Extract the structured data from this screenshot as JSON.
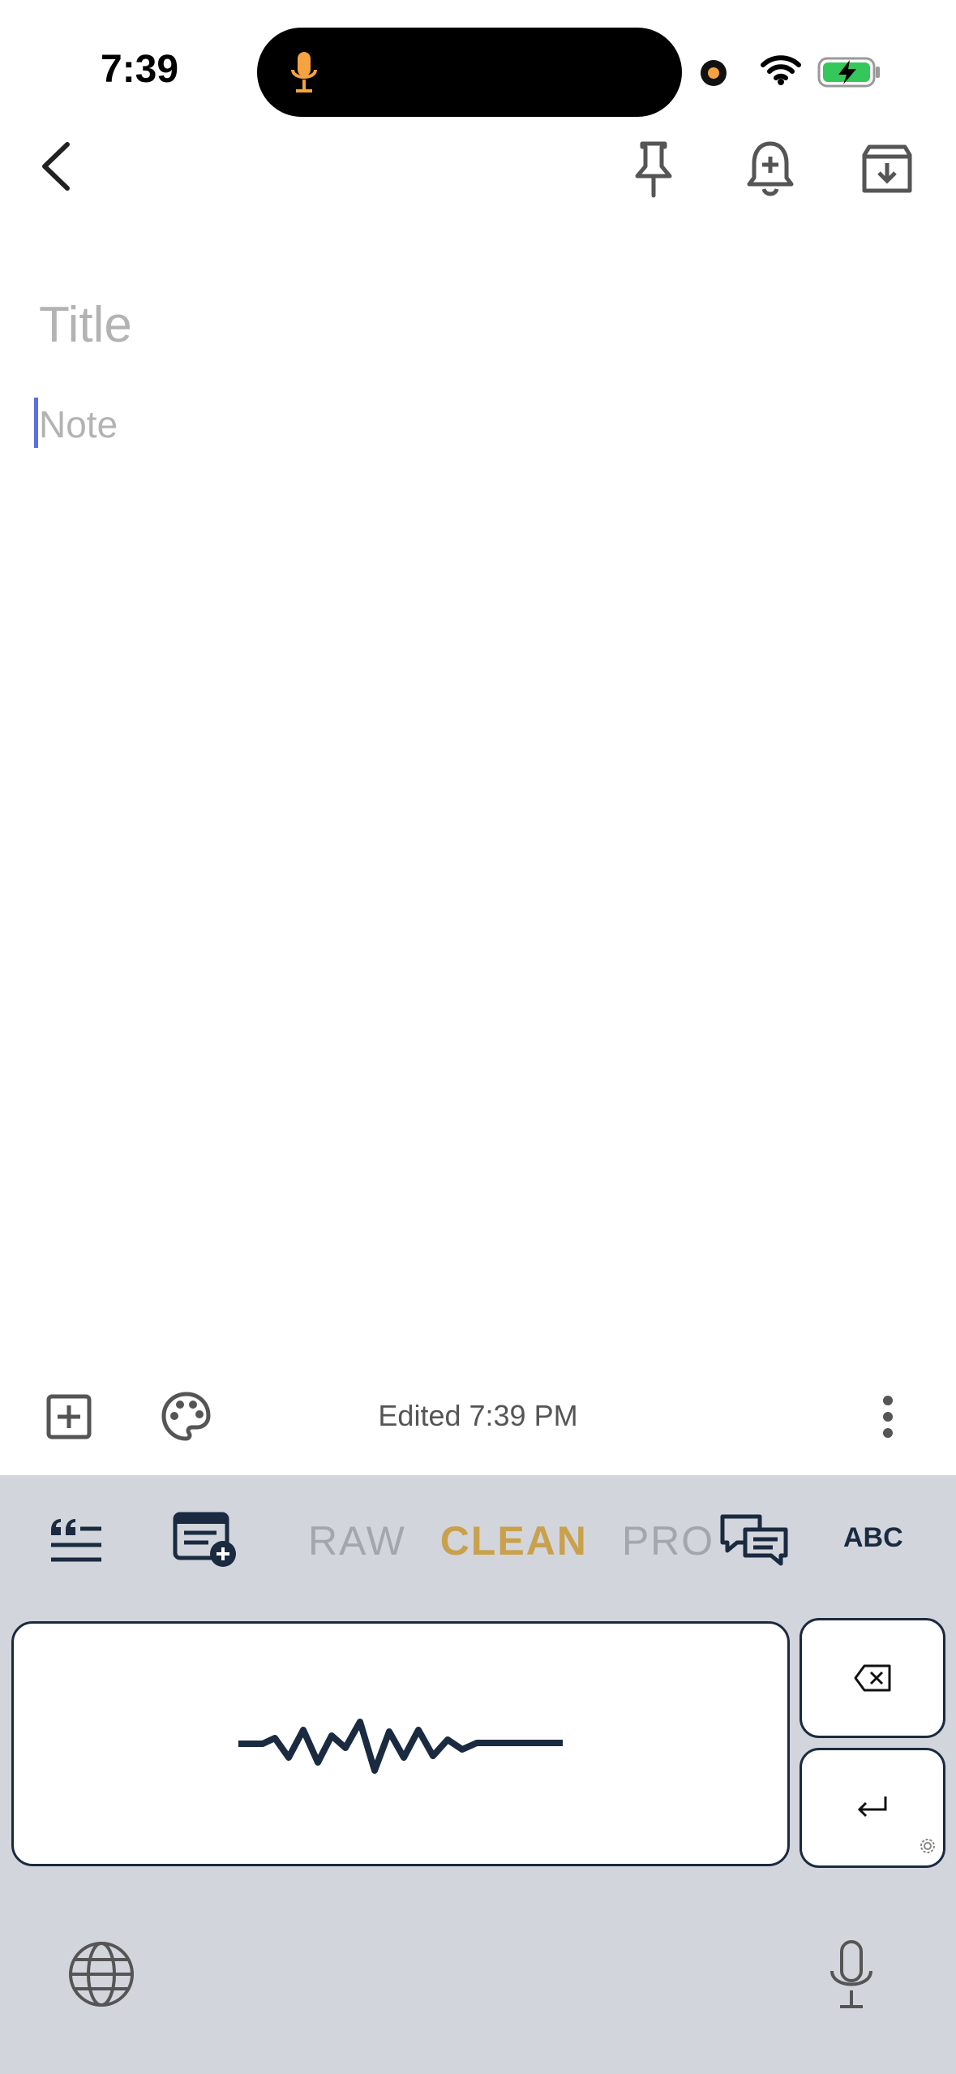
{
  "status_bar": {
    "time": "7:39"
  },
  "icons": {
    "back": "chevron-left-icon",
    "pin": "pin-icon",
    "reminder": "bell-plus-icon",
    "archive": "archive-icon",
    "add": "plus-square-icon",
    "palette": "palette-icon",
    "more": "more-vertical-icon",
    "quote": "quote-icon",
    "new_note": "note-add-icon",
    "chat": "chat-icon",
    "delete": "backspace-icon",
    "return": "return-icon",
    "globe": "globe-icon",
    "mic": "microphone-icon"
  },
  "note": {
    "title_placeholder": "Title",
    "body_placeholder": "Note"
  },
  "footer": {
    "edited": "Edited 7:39 PM"
  },
  "keyboard": {
    "modes": [
      "RAW",
      "CLEAN",
      "PRO"
    ],
    "active_mode": "CLEAN",
    "abc_label": "ABC"
  },
  "colors": {
    "accent": "#c9a14c",
    "navy": "#1a2a40",
    "caret": "#5a6fe0",
    "keyboard_bg": "#d3d5dc",
    "mic_indicator": "#f4a340"
  }
}
